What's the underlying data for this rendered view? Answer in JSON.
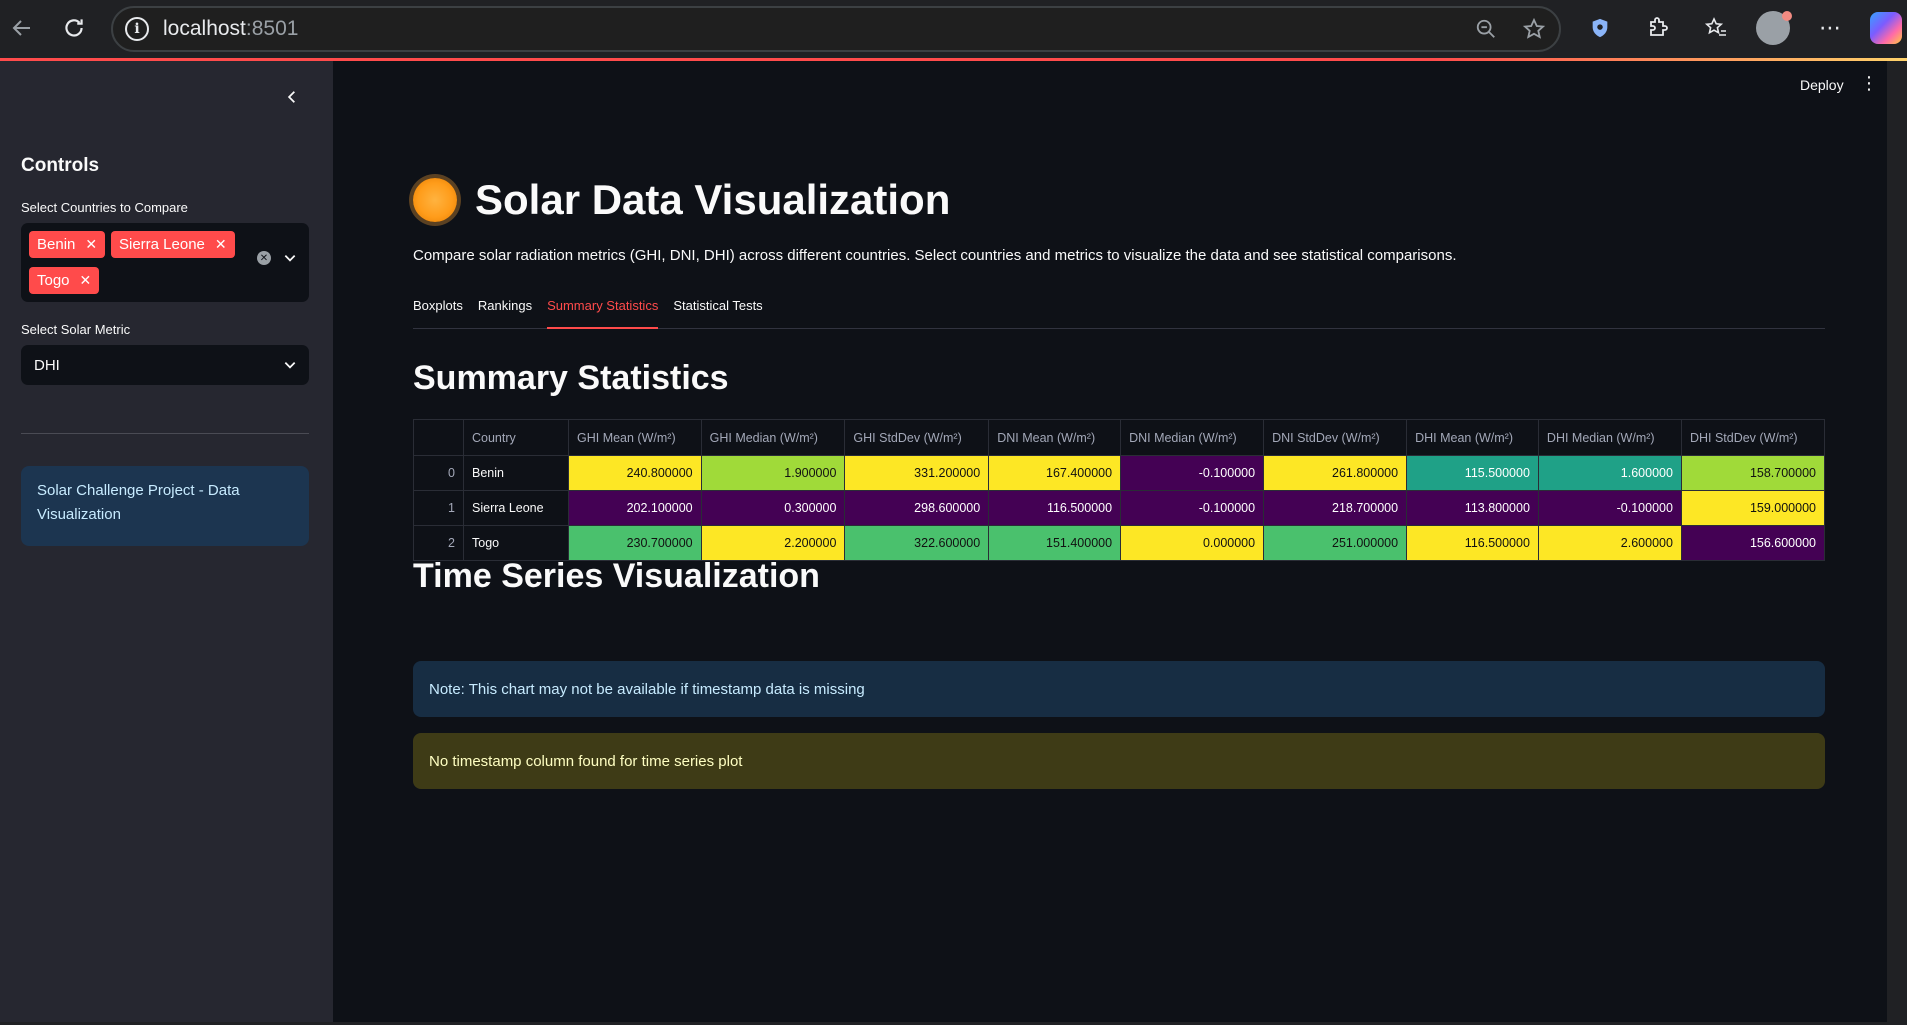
{
  "browser": {
    "url_host": "localhost",
    "url_port": ":8501"
  },
  "header": {
    "deploy_label": "Deploy"
  },
  "sidebar": {
    "title": "Controls",
    "countries_label": "Select Countries to Compare",
    "countries": [
      "Benin",
      "Sierra Leone",
      "Togo"
    ],
    "metric_label": "Select Solar Metric",
    "metric_value": "DHI",
    "info_text": "Solar Challenge Project - Data Visualization"
  },
  "main": {
    "title": "Solar Data Visualization",
    "description": "Compare solar radiation metrics (GHI, DNI, DHI) across different countries. Select countries and metrics to visualize the data and see statistical comparisons.",
    "tabs": [
      "Boxplots",
      "Rankings",
      "Summary Statistics",
      "Statistical Tests"
    ],
    "active_tab": "Summary Statistics",
    "summary_heading": "Summary Statistics",
    "timeseries_heading": "Time Series Visualization",
    "note_text": "Note: This chart may not be available if timestamp data is missing",
    "warning_text": "No timestamp column found for time series plot"
  },
  "table": {
    "columns": [
      "",
      "Country",
      "GHI Mean (W/m²)",
      "GHI Median (W/m²)",
      "GHI StdDev (W/m²)",
      "DNI Mean (W/m²)",
      "DNI Median (W/m²)",
      "DNI StdDev (W/m²)",
      "DHI Mean (W/m²)",
      "DHI Median (W/m²)",
      "DHI StdDev (W/m²)"
    ],
    "rows": [
      {
        "idx": "0",
        "country": "Benin",
        "values": [
          "240.800000",
          "1.900000",
          "331.200000",
          "167.400000",
          "-0.100000",
          "261.800000",
          "115.500000",
          "1.600000",
          "158.700000"
        ],
        "colors": [
          "c-yellow",
          "c-lime",
          "c-yellow",
          "c-yellow",
          "c-purple",
          "c-yellow",
          "c-teal",
          "c-teal",
          "c-lime"
        ]
      },
      {
        "idx": "1",
        "country": "Sierra Leone",
        "values": [
          "202.100000",
          "0.300000",
          "298.600000",
          "116.500000",
          "-0.100000",
          "218.700000",
          "113.800000",
          "-0.100000",
          "159.000000"
        ],
        "colors": [
          "c-purple",
          "c-purple",
          "c-purple",
          "c-purple",
          "c-purple",
          "c-purple",
          "c-purple",
          "c-purple",
          "c-yellow"
        ]
      },
      {
        "idx": "2",
        "country": "Togo",
        "values": [
          "230.700000",
          "2.200000",
          "322.600000",
          "151.400000",
          "0.000000",
          "251.000000",
          "116.500000",
          "2.600000",
          "156.600000"
        ],
        "colors": [
          "c-green",
          "c-yellow",
          "c-green",
          "c-green",
          "c-yellow",
          "c-green",
          "c-yellow",
          "c-yellow",
          "c-purple"
        ]
      }
    ]
  }
}
